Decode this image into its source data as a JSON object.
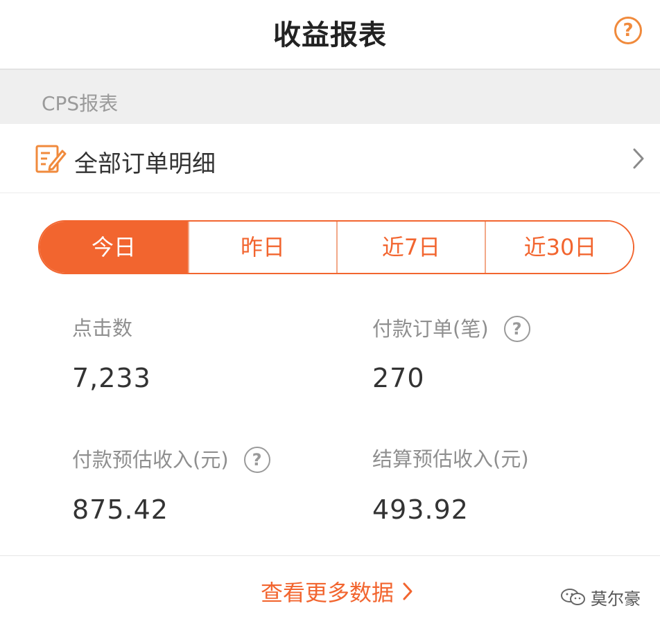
{
  "header": {
    "title": "收益报表"
  },
  "section": {
    "title": "CPS报表"
  },
  "order_detail": {
    "label": "全部订单明细"
  },
  "tabs": [
    {
      "label": "今日",
      "active": true
    },
    {
      "label": "昨日",
      "active": false
    },
    {
      "label": "近7日",
      "active": false
    },
    {
      "label": "近30日",
      "active": false
    }
  ],
  "metrics": [
    {
      "label": "点击数",
      "value": "7,233",
      "help": false
    },
    {
      "label": "付款订单(笔)",
      "value": "270",
      "help": true
    },
    {
      "label": "付款预估收入(元)",
      "value": "875.42",
      "help": true
    },
    {
      "label": "结算预估收入(元)",
      "value": "493.92",
      "help": false
    }
  ],
  "more_link": {
    "label": "查看更多数据"
  },
  "watermark": {
    "text": "莫尔豪"
  },
  "icons": {
    "help": "?"
  },
  "colors": {
    "accent": "#f2652f",
    "help_icon": "#f08a3c",
    "muted_text": "#8f8f8f"
  }
}
